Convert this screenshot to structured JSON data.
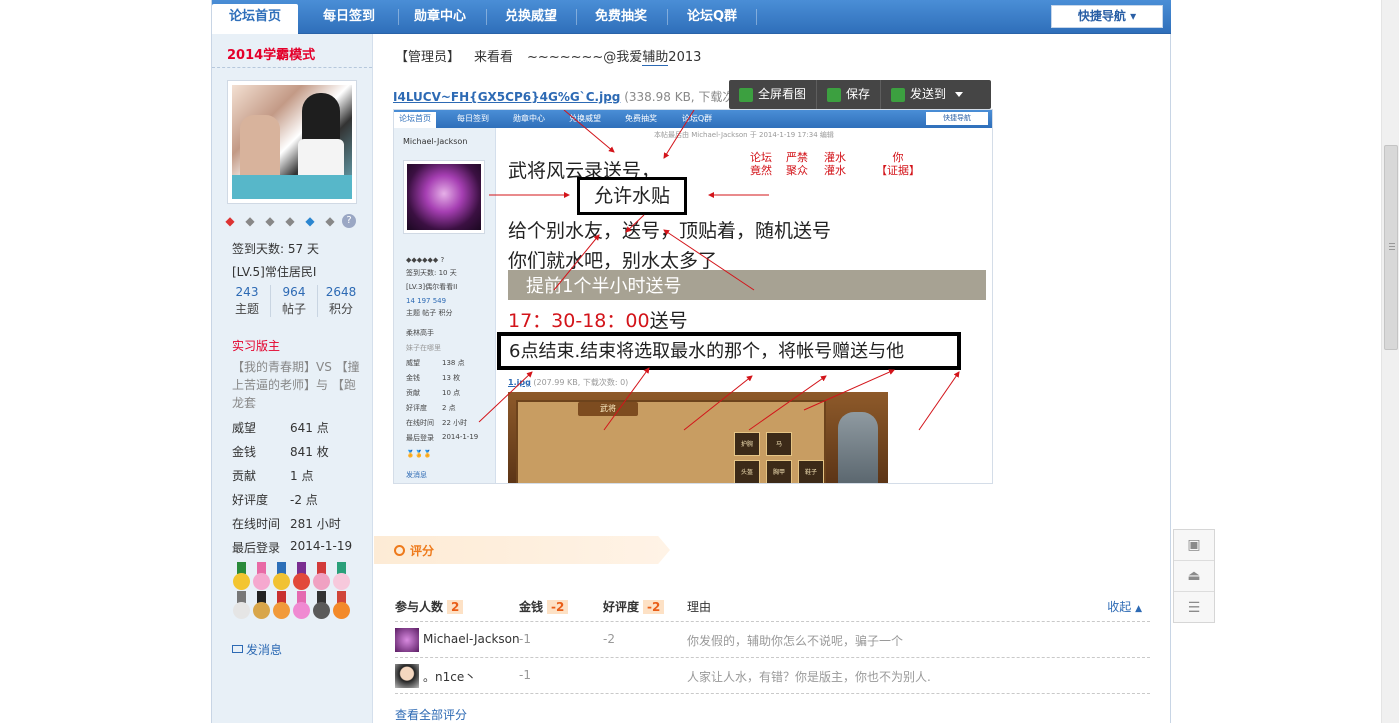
{
  "nav": {
    "tabs": [
      "论坛首页",
      "每日签到",
      "勋章中心",
      "兑换威望",
      "免费抽奖",
      "论坛Q群"
    ],
    "active": 0,
    "quick_nav": "快捷导航"
  },
  "sidebar": {
    "username": "2014学霸模式",
    "sign_days": "签到天数: 57 天",
    "level": "[LV.5]常住居民I",
    "stats": [
      {
        "num": "243",
        "label": "主题"
      },
      {
        "num": "964",
        "label": "帖子"
      },
      {
        "num": "2648",
        "label": "积分"
      }
    ],
    "title": "实习版主",
    "signature": "【我的青春期】VS 【撞上苦逼的老师】与 【跑龙套",
    "fields": [
      {
        "k": "威望",
        "v": "641 点"
      },
      {
        "k": "金钱",
        "v": "841 枚"
      },
      {
        "k": "贡献",
        "v": "1 点"
      },
      {
        "k": "好评度",
        "v": "-2 点"
      },
      {
        "k": "在线时间",
        "v": "281 小时"
      },
      {
        "k": "最后登录",
        "v": "2014-1-19"
      }
    ],
    "send_pm": "发消息"
  },
  "post": {
    "role": "【管理员】",
    "text1": "来看看",
    "text2": "~~~~~~~@我爱",
    "text3": "辅助",
    "text4": "2013",
    "attachment": {
      "filename": "I4LUCV~FH{GX5CP6}4G%G`C.jpg",
      "meta": "(338.98 KB, 下载次数:"
    }
  },
  "image_toolbar": {
    "fullscreen": "全屏看图",
    "save": "保存",
    "send": "发送到"
  },
  "screenshot": {
    "nav_tabs": [
      "论坛首页",
      "每日签到",
      "勋章中心",
      "兑换威望",
      "免费抽奖",
      "论坛Q群"
    ],
    "quick_nav": "快捷导航",
    "meta": "本帖最后由 Michael-Jackson 于 2014-1-19 17:34 编辑",
    "username": "Michael-Jackson",
    "sign_days": "签到天数: 10 天",
    "level": "[LV.3]偶尔看看II",
    "stats_nums": "14      197      549",
    "stats_labels": "主题     帖子     积分",
    "title": "柔林高手",
    "signature": "妹子在哪里",
    "fields": [
      {
        "k": "威望",
        "v": "138 点"
      },
      {
        "k": "金钱",
        "v": "13 枚"
      },
      {
        "k": "贡献",
        "v": "10 点"
      },
      {
        "k": "好评度",
        "v": "2 点"
      },
      {
        "k": "在线时间",
        "v": "22 小时"
      },
      {
        "k": "最后登录",
        "v": "2014-1-19"
      }
    ],
    "pm": "发消息",
    "line1": "武将风云录送号，",
    "box1": "允许水贴",
    "red1": "论坛\n竟然",
    "red2": "严禁\n聚众",
    "red3": "灌水\n灌水",
    "red4": "你\n【证据】",
    "line2": "给个别水友，送号，顶贴着，随机送号",
    "line3": "你们就水吧，别水太多了",
    "band": "提前1个半小时送号",
    "time_red": "17：30-18：00",
    "time_tail": "送号",
    "box2": "6点结束.结束将选取最水的那个，将帐号赠送与他",
    "att_name": "1.jpg",
    "att_meta": "(207.99 KB, 下载次数: 0)",
    "game_title": "武将",
    "game_slots": [
      "护腕",
      "马",
      "头盔",
      "胸甲",
      "鞋子"
    ]
  },
  "rating": {
    "header": "评分",
    "columns": {
      "participants": "参与人数",
      "participants_count": "2",
      "money": "金钱",
      "money_total": "-2",
      "reputation": "好评度",
      "reputation_total": "-2",
      "reason": "理由"
    },
    "collapse": "收起",
    "rows": [
      {
        "user": "Michael-Jackson",
        "money": "-1",
        "rep": "-2",
        "reason": "你发假的，辅助你怎么不说呢，骗子一个"
      },
      {
        "user": "。n1ce丶",
        "money": "-1",
        "rep": "",
        "reason": "人家让人水，有错？你是版主，你也不为别人."
      }
    ],
    "view_all": "查看全部评分"
  },
  "colors": {
    "nav_blue": "#2f6fba",
    "accent_red": "#e4002b",
    "link_blue": "#2d6ab4",
    "rating_orange": "#ee7a1b"
  }
}
